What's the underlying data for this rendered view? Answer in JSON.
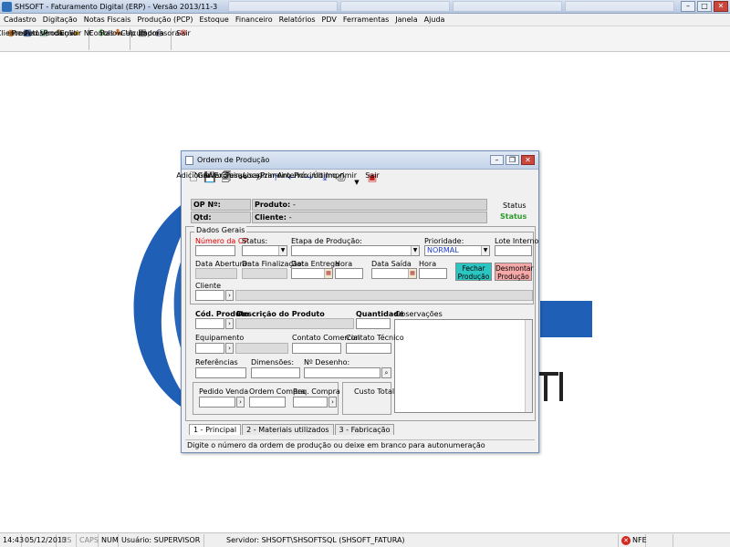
{
  "app": {
    "title": "SHSOFT - Faturamento Digital (ERP) - Versão 2013/11-3"
  },
  "menu": [
    "Cadastro",
    "Digitação",
    "Notas Fiscais",
    "Produção (PCP)",
    "Estoque",
    "Financeiro",
    "Relatórios",
    "PDV",
    "Ferramentas",
    "Janela",
    "Ajuda"
  ],
  "toolbar": [
    {
      "label": "Clientes",
      "icon": "users-icon"
    },
    {
      "label": "Produtos",
      "icon": "box-icon"
    },
    {
      "label": "Ped.Venda",
      "icon": "order-icon"
    },
    {
      "label": "Produção",
      "icon": "pencil-icon"
    },
    {
      "label": "Emitir NF",
      "icon": "folder-icon"
    },
    {
      "label": "Contas",
      "icon": "money-icon"
    },
    {
      "label": "Follow-Up",
      "icon": "followup-icon"
    },
    {
      "label": "Calculadora",
      "icon": "calculator-icon"
    },
    {
      "label": "Impressora",
      "icon": "printer-icon"
    },
    {
      "label": "Sair",
      "icon": "exit-icon"
    }
  ],
  "child": {
    "title": "Ordem de Produção",
    "toolbar": [
      {
        "label": "Adicionar",
        "icon": "new-doc-icon"
      },
      {
        "label": "Gravar",
        "icon": "save-icon"
      },
      {
        "label": "Excluir",
        "icon": "delete-icon"
      },
      {
        "label": "Pesquisar",
        "icon": "binoculars-icon"
      },
      {
        "label": "Localizar",
        "icon": "find-icon"
      },
      {
        "label": "Primeiro",
        "icon": "first-icon"
      },
      {
        "label": "Anterior",
        "icon": "previous-icon"
      },
      {
        "label": "Próximo",
        "icon": "next-icon"
      },
      {
        "label": "Último",
        "icon": "last-icon"
      },
      {
        "label": "Imprimir",
        "icon": "print-icon"
      },
      {
        "label": "Sair",
        "icon": "exit-icon"
      }
    ],
    "header": {
      "op_label": "OP Nº:",
      "produto_label": "Produto:",
      "produto_value": "-",
      "qtd_label": "Qtd:",
      "cliente_label": "Cliente:",
      "cliente_value": "-",
      "status_label": "Status",
      "status_value": "Status"
    },
    "dados_gerais": {
      "legend": "Dados Gerais",
      "numero_op": "Número da OP",
      "status": "Status:",
      "etapa": "Etapa de Produção:",
      "prioridade": "Prioridade:",
      "prioridade_value": "NORMAL",
      "lote": "Lote Interno",
      "data_abertura": "Data Abertura:",
      "data_finalizacao": "Data Finalização:",
      "data_entrega": "Data Entrega",
      "hora1": "Hora",
      "data_saida": "Data Saída",
      "hora2": "Hora",
      "fechar_btn": "Fechar Produção",
      "desmontar_btn": "Desmontar Produção",
      "cliente": "Cliente"
    },
    "produto": {
      "cod": "Cód. Produto",
      "descricao": "Descrição do Produto",
      "quantidade": "Quantidade",
      "observacoes": "Observações",
      "equipamento": "Equipamento",
      "contato_comercial": "Contato Comercial",
      "contato_tecnico": "Contato Técnico",
      "referencias": "Referências",
      "dimensoes": "Dimensões:",
      "desenho": "Nº Desenho:",
      "pedido_venda": "Pedido Venda",
      "ordem_compra": "Ordem Compra",
      "req_compra": "Req. Compra",
      "custo_total": "Custo Total"
    },
    "tabs": [
      "1 - Principal",
      "2 - Materiais utilizados",
      "3 - Fabricação"
    ],
    "hint": "Digite o número da ordem de produção ou deixe em branco para autonumeração"
  },
  "statusbar": {
    "time": "14:43",
    "date": "05/12/2013",
    "ins": "INS",
    "caps": "CAPS",
    "num": "NUM",
    "user": "Usuário: SUPERVISOR",
    "server": "Servidor: SHSOFT\\SHSOFTSQL (SHSOFT_FATURA)",
    "nfe": "NFE"
  },
  "colors": {
    "status_green": "#2c9a2c",
    "required_red": "#e10000",
    "fechar_teal": "#2bc5c2",
    "desmontar_pink": "#f6a8a8",
    "logo_blue": "#1f5fb5"
  }
}
